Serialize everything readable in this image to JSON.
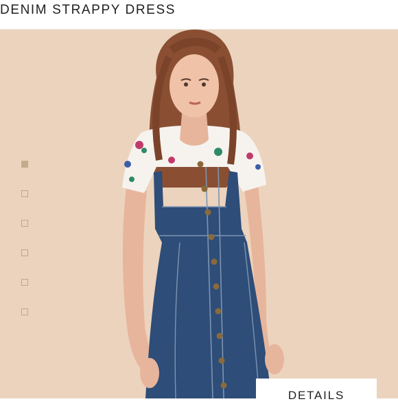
{
  "header": {
    "title": "DENIM STRAPPY DRESS"
  },
  "gallery": {
    "thumbnails": [
      {
        "active": true
      },
      {
        "active": false
      },
      {
        "active": false
      },
      {
        "active": false
      },
      {
        "active": false
      },
      {
        "active": false
      }
    ]
  },
  "actions": {
    "details_label": "DETAILS"
  },
  "colors": {
    "background": "#ecd3bd",
    "denim": "#2e4d78",
    "accent": "#c4ab8b"
  }
}
